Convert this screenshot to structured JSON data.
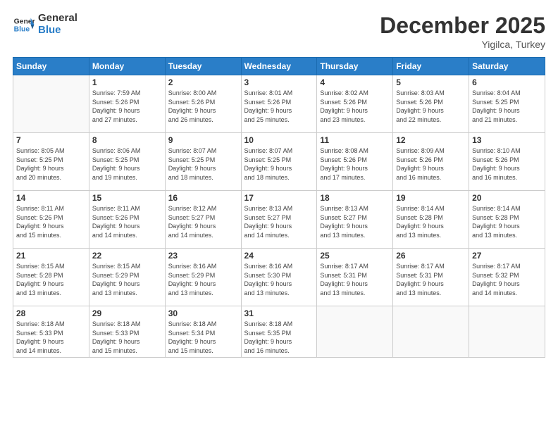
{
  "logo": {
    "line1": "General",
    "line2": "Blue"
  },
  "header": {
    "month": "December 2025",
    "location": "Yigilca, Turkey"
  },
  "days_of_week": [
    "Sunday",
    "Monday",
    "Tuesday",
    "Wednesday",
    "Thursday",
    "Friday",
    "Saturday"
  ],
  "weeks": [
    [
      {
        "day": "",
        "info": ""
      },
      {
        "day": "1",
        "info": "Sunrise: 7:59 AM\nSunset: 5:26 PM\nDaylight: 9 hours\nand 27 minutes."
      },
      {
        "day": "2",
        "info": "Sunrise: 8:00 AM\nSunset: 5:26 PM\nDaylight: 9 hours\nand 26 minutes."
      },
      {
        "day": "3",
        "info": "Sunrise: 8:01 AM\nSunset: 5:26 PM\nDaylight: 9 hours\nand 25 minutes."
      },
      {
        "day": "4",
        "info": "Sunrise: 8:02 AM\nSunset: 5:26 PM\nDaylight: 9 hours\nand 23 minutes."
      },
      {
        "day": "5",
        "info": "Sunrise: 8:03 AM\nSunset: 5:26 PM\nDaylight: 9 hours\nand 22 minutes."
      },
      {
        "day": "6",
        "info": "Sunrise: 8:04 AM\nSunset: 5:25 PM\nDaylight: 9 hours\nand 21 minutes."
      }
    ],
    [
      {
        "day": "7",
        "info": "Sunrise: 8:05 AM\nSunset: 5:25 PM\nDaylight: 9 hours\nand 20 minutes."
      },
      {
        "day": "8",
        "info": "Sunrise: 8:06 AM\nSunset: 5:25 PM\nDaylight: 9 hours\nand 19 minutes."
      },
      {
        "day": "9",
        "info": "Sunrise: 8:07 AM\nSunset: 5:25 PM\nDaylight: 9 hours\nand 18 minutes."
      },
      {
        "day": "10",
        "info": "Sunrise: 8:07 AM\nSunset: 5:25 PM\nDaylight: 9 hours\nand 18 minutes."
      },
      {
        "day": "11",
        "info": "Sunrise: 8:08 AM\nSunset: 5:26 PM\nDaylight: 9 hours\nand 17 minutes."
      },
      {
        "day": "12",
        "info": "Sunrise: 8:09 AM\nSunset: 5:26 PM\nDaylight: 9 hours\nand 16 minutes."
      },
      {
        "day": "13",
        "info": "Sunrise: 8:10 AM\nSunset: 5:26 PM\nDaylight: 9 hours\nand 16 minutes."
      }
    ],
    [
      {
        "day": "14",
        "info": "Sunrise: 8:11 AM\nSunset: 5:26 PM\nDaylight: 9 hours\nand 15 minutes."
      },
      {
        "day": "15",
        "info": "Sunrise: 8:11 AM\nSunset: 5:26 PM\nDaylight: 9 hours\nand 14 minutes."
      },
      {
        "day": "16",
        "info": "Sunrise: 8:12 AM\nSunset: 5:27 PM\nDaylight: 9 hours\nand 14 minutes."
      },
      {
        "day": "17",
        "info": "Sunrise: 8:13 AM\nSunset: 5:27 PM\nDaylight: 9 hours\nand 14 minutes."
      },
      {
        "day": "18",
        "info": "Sunrise: 8:13 AM\nSunset: 5:27 PM\nDaylight: 9 hours\nand 13 minutes."
      },
      {
        "day": "19",
        "info": "Sunrise: 8:14 AM\nSunset: 5:28 PM\nDaylight: 9 hours\nand 13 minutes."
      },
      {
        "day": "20",
        "info": "Sunrise: 8:14 AM\nSunset: 5:28 PM\nDaylight: 9 hours\nand 13 minutes."
      }
    ],
    [
      {
        "day": "21",
        "info": "Sunrise: 8:15 AM\nSunset: 5:28 PM\nDaylight: 9 hours\nand 13 minutes."
      },
      {
        "day": "22",
        "info": "Sunrise: 8:15 AM\nSunset: 5:29 PM\nDaylight: 9 hours\nand 13 minutes."
      },
      {
        "day": "23",
        "info": "Sunrise: 8:16 AM\nSunset: 5:29 PM\nDaylight: 9 hours\nand 13 minutes."
      },
      {
        "day": "24",
        "info": "Sunrise: 8:16 AM\nSunset: 5:30 PM\nDaylight: 9 hours\nand 13 minutes."
      },
      {
        "day": "25",
        "info": "Sunrise: 8:17 AM\nSunset: 5:31 PM\nDaylight: 9 hours\nand 13 minutes."
      },
      {
        "day": "26",
        "info": "Sunrise: 8:17 AM\nSunset: 5:31 PM\nDaylight: 9 hours\nand 13 minutes."
      },
      {
        "day": "27",
        "info": "Sunrise: 8:17 AM\nSunset: 5:32 PM\nDaylight: 9 hours\nand 14 minutes."
      }
    ],
    [
      {
        "day": "28",
        "info": "Sunrise: 8:18 AM\nSunset: 5:33 PM\nDaylight: 9 hours\nand 14 minutes."
      },
      {
        "day": "29",
        "info": "Sunrise: 8:18 AM\nSunset: 5:33 PM\nDaylight: 9 hours\nand 15 minutes."
      },
      {
        "day": "30",
        "info": "Sunrise: 8:18 AM\nSunset: 5:34 PM\nDaylight: 9 hours\nand 15 minutes."
      },
      {
        "day": "31",
        "info": "Sunrise: 8:18 AM\nSunset: 5:35 PM\nDaylight: 9 hours\nand 16 minutes."
      },
      {
        "day": "",
        "info": ""
      },
      {
        "day": "",
        "info": ""
      },
      {
        "day": "",
        "info": ""
      }
    ]
  ]
}
